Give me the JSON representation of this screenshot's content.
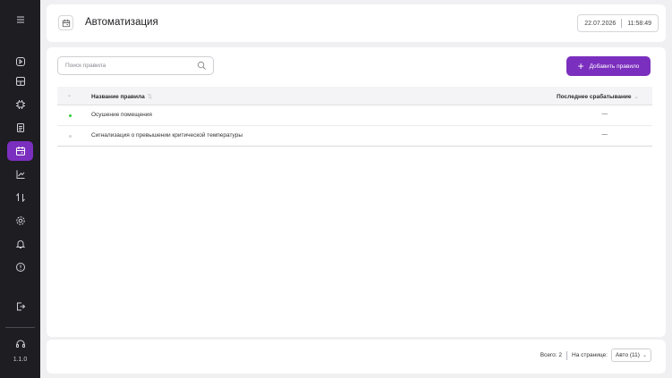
{
  "app": {
    "version": "1.1.0"
  },
  "header": {
    "title": "Автоматизация",
    "date": "22.07.2026",
    "time": "11:58:49"
  },
  "search": {
    "placeholder": "Поиск правила"
  },
  "toolbar": {
    "add_label": "Добавить правило",
    "accent": "#7b2fbe"
  },
  "table": {
    "columns": {
      "name": "Название правила",
      "last": "Последнее срабатывание"
    },
    "rows": [
      {
        "name": "Осушение помещения",
        "last": "—",
        "status": "active",
        "status_color": "#2ecc40"
      },
      {
        "name": "Сигнализация о превышении критической температуры",
        "last": "—",
        "status": "inactive",
        "status_color": "#d4d4d8"
      }
    ]
  },
  "footer": {
    "total": "Всего: 2",
    "per_page_label": "На странице:",
    "per_page_value": "Авто (11)"
  },
  "sidebar": {
    "icons": [
      "menu-icon",
      "play-icon",
      "dashboard-icon",
      "devices-icon",
      "document-icon",
      "automation-icon",
      "chart-icon",
      "transfer-icon",
      "settings-icon",
      "bell-icon",
      "info-icon",
      "logout-icon",
      "support-icon"
    ]
  }
}
